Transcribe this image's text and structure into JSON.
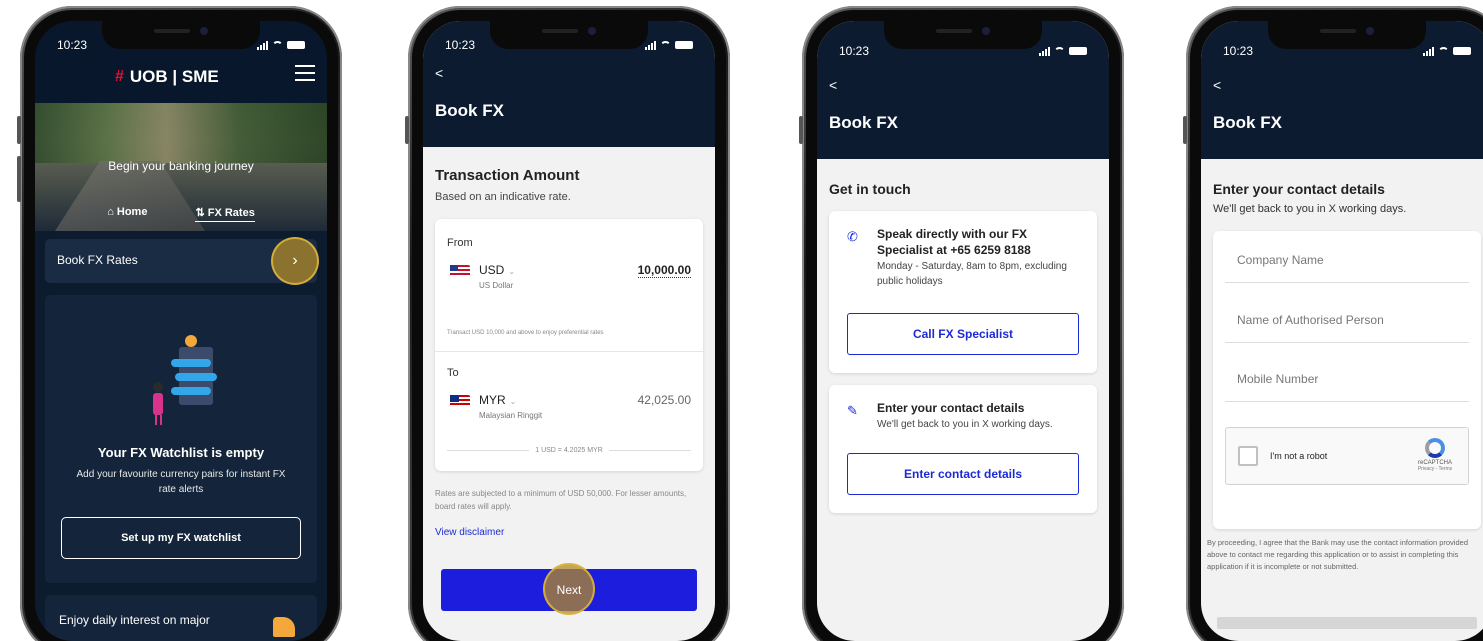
{
  "status_time": "10:23",
  "screen1": {
    "brand": "UOB | SME",
    "hero_text": "Begin your banking journey",
    "tabs": [
      "Home",
      "FX Rates"
    ],
    "book_fx_label": "Book FX Rates",
    "watchlist_title": "Your FX Watchlist is empty",
    "watchlist_sub": "Add your favourite currency pairs for instant FX rate alerts",
    "watchlist_button": "Set up my FX watchlist",
    "promo_text": "Enjoy daily interest on major"
  },
  "screen2": {
    "back": "<",
    "title": "Book FX",
    "section_title": "Transaction Amount",
    "section_sub": "Based on an indicative rate.",
    "from_label": "From",
    "from_currency": "USD",
    "from_currency_name": "US Dollar",
    "from_amount": "10,000.00",
    "preferential_note": "Transact USD 10,000 and above to enjoy preferential rates",
    "to_label": "To",
    "to_currency": "MYR",
    "to_currency_name": "Malaysian Ringgit",
    "to_amount": "42,025.00",
    "rate": "1 USD = 4.2025 MYR",
    "disclaimer_text": "Rates are subjected to a minimum of USD 50,000. For lesser amounts, board rates will apply.",
    "view_disclaimer": "View disclaimer",
    "next_button": "Next"
  },
  "screen3": {
    "back": "<",
    "title": "Book FX",
    "section_title": "Get in touch",
    "speak_title": "Speak directly with our FX Specialist at +65 6259 8188",
    "speak_hours": "Monday - Saturday, 8am to 8pm, excluding public holidays",
    "call_button": "Call FX Specialist",
    "contact_title": "Enter your contact details",
    "contact_sub": "We'll get back to you in X working days.",
    "contact_button": "Enter contact details"
  },
  "screen4": {
    "back": "<",
    "title": "Book FX",
    "section_title": "Enter your contact details",
    "section_sub": "We'll get back to you in X working days.",
    "company_placeholder": "Company Name",
    "person_placeholder": "Name of Authorised Person",
    "mobile_placeholder": "Mobile Number",
    "captcha_text": "I'm not a robot",
    "captcha_brand": "reCAPTCHA",
    "captcha_links": "Privacy - Terms",
    "legal": "By proceeding, I agree that the Bank may use the contact information provided above to contact me regarding this application or to assist in completing this application if it is incomplete or not submitted."
  },
  "colors": {
    "navy": "#0c1b30",
    "accent_blue": "#1d1ddd",
    "highlight_gold": "#b28a28",
    "uob_red": "#e8112d"
  }
}
